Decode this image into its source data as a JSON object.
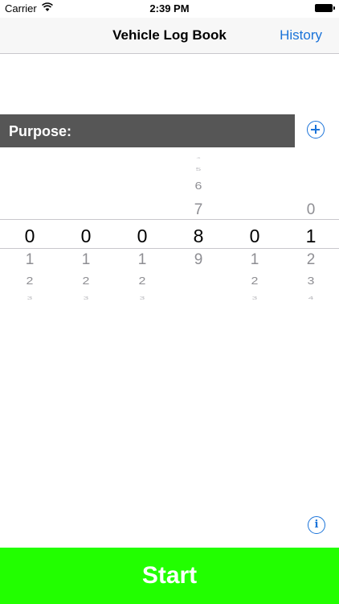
{
  "status_bar": {
    "carrier": "Carrier",
    "time": "2:39 PM",
    "wifi_icon": "wifi-icon",
    "battery_icon": "battery-icon"
  },
  "navbar": {
    "title": "Vehicle Log Book",
    "history_label": "History"
  },
  "purpose": {
    "label": "Purpose:",
    "add_icon": "plus-circle-icon"
  },
  "odometer": {
    "selected": [
      "0",
      "0",
      "0",
      "8",
      "0",
      "1"
    ],
    "columns": [
      {
        "above": [],
        "below": [
          "1",
          "2",
          "3"
        ]
      },
      {
        "above": [],
        "below": [
          "1",
          "2",
          "3"
        ]
      },
      {
        "above": [],
        "below": [
          "1",
          "2",
          "3"
        ]
      },
      {
        "above": [
          "7",
          "6",
          "5",
          "4"
        ],
        "below": [
          "9"
        ]
      },
      {
        "above": [],
        "below": [
          "1",
          "2",
          "3"
        ]
      },
      {
        "above": [
          "0"
        ],
        "below": [
          "2",
          "3",
          "4"
        ]
      }
    ]
  },
  "info_icon": "info-circle-icon",
  "info_glyph": "i",
  "start_label": "Start",
  "colors": {
    "accent": "#1a73d9",
    "start_button": "#22ff00",
    "purpose_bar": "#565656"
  }
}
